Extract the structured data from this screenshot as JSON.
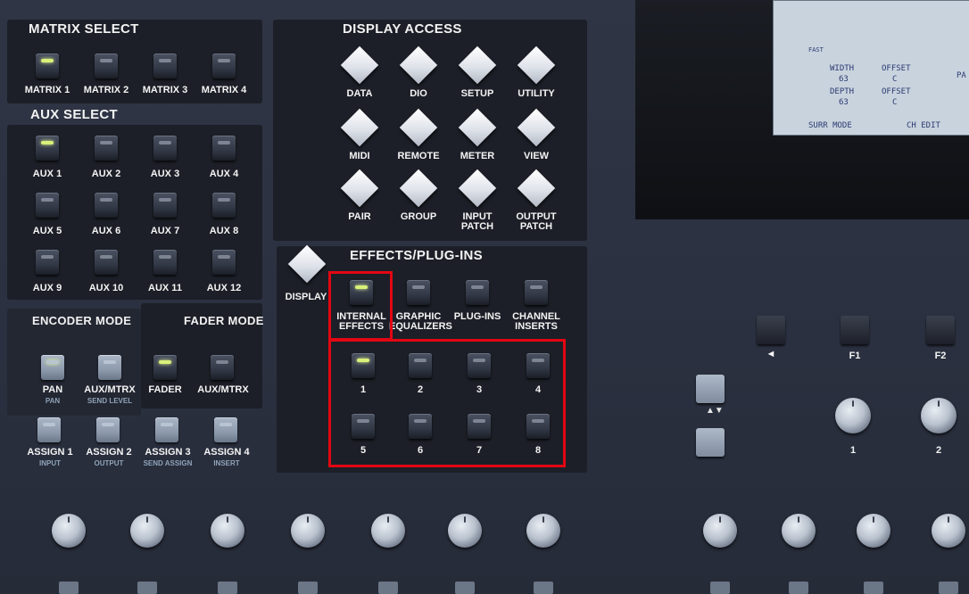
{
  "colors": {
    "accent": "#e30613",
    "led_on": "#d9f07a",
    "panel": "#1c1f27"
  },
  "matrix_select": {
    "title": "MATRIX SELECT",
    "buttons": [
      {
        "label": "MATRIX 1",
        "led": "on"
      },
      {
        "label": "MATRIX 2",
        "led": "off"
      },
      {
        "label": "MATRIX 3",
        "led": "off"
      },
      {
        "label": "MATRIX 4",
        "led": "off"
      }
    ]
  },
  "aux_select": {
    "title": "AUX SELECT",
    "buttons": [
      {
        "label": "AUX 1",
        "led": "on"
      },
      {
        "label": "AUX 2",
        "led": "off"
      },
      {
        "label": "AUX 3",
        "led": "off"
      },
      {
        "label": "AUX 4",
        "led": "off"
      },
      {
        "label": "AUX 5",
        "led": "off"
      },
      {
        "label": "AUX 6",
        "led": "off"
      },
      {
        "label": "AUX 7",
        "led": "off"
      },
      {
        "label": "AUX 8",
        "led": "off"
      },
      {
        "label": "AUX 9",
        "led": "off"
      },
      {
        "label": "AUX 10",
        "led": "off"
      },
      {
        "label": "AUX 11",
        "led": "off"
      },
      {
        "label": "AUX 12",
        "led": "off"
      }
    ]
  },
  "encoder_mode": {
    "title": "ENCODER MODE",
    "buttons": [
      {
        "label": "PAN",
        "sub": "PAN",
        "led": "on"
      },
      {
        "label": "AUX/MTRX",
        "sub": "SEND LEVEL",
        "led": "off"
      }
    ]
  },
  "fader_mode": {
    "title": "FADER MODE",
    "buttons": [
      {
        "label": "FADER",
        "led": "on"
      },
      {
        "label": "AUX/MTRX",
        "led": "off"
      }
    ]
  },
  "assign": {
    "buttons": [
      {
        "label": "ASSIGN 1",
        "sub": "INPUT"
      },
      {
        "label": "ASSIGN 2",
        "sub": "OUTPUT"
      },
      {
        "label": "ASSIGN 3",
        "sub": "SEND ASSIGN"
      },
      {
        "label": "ASSIGN 4",
        "sub": "INSERT"
      }
    ]
  },
  "display_access": {
    "title": "DISPLAY ACCESS",
    "keys": [
      {
        "label": "DATA"
      },
      {
        "label": "DIO"
      },
      {
        "label": "SETUP"
      },
      {
        "label": "UTILITY"
      },
      {
        "label": "MIDI"
      },
      {
        "label": "REMOTE"
      },
      {
        "label": "METER"
      },
      {
        "label": "VIEW"
      },
      {
        "label": "PAIR"
      },
      {
        "label": "GROUP"
      },
      {
        "label": "INPUT\nPATCH"
      },
      {
        "label": "OUTPUT\nPATCH"
      }
    ]
  },
  "effects": {
    "title": "EFFECTS/PLUG-INS",
    "display_label": "DISPLAY",
    "categories": [
      {
        "label": "INTERNAL\nEFFECTS",
        "led": "on"
      },
      {
        "label": "GRAPHIC\nEQUALIZERS",
        "led": "off"
      },
      {
        "label": "PLUG-INS",
        "led": "off"
      },
      {
        "label": "CHANNEL\nINSERTS",
        "led": "off"
      }
    ],
    "slots": [
      {
        "label": "1",
        "led": "on"
      },
      {
        "label": "2",
        "led": "off"
      },
      {
        "label": "3",
        "led": "off"
      },
      {
        "label": "4",
        "led": "off"
      },
      {
        "label": "5",
        "led": "off"
      },
      {
        "label": "6",
        "led": "off"
      },
      {
        "label": "7",
        "led": "off"
      },
      {
        "label": "8",
        "led": "off"
      }
    ]
  },
  "lcd": {
    "width_label": "WIDTH",
    "offset_label": "OFFSET",
    "depth_label": "DEPTH",
    "offset2_label": "OFFSET",
    "width_value": "63",
    "offset_value": "C",
    "depth_value": "63",
    "offset2_value": "C",
    "tab1": "SURR MODE",
    "tab2": "CH EDIT",
    "fast_label": "FAST",
    "pa_label": "PA"
  },
  "function_keys": {
    "left_arrow": "◄",
    "f1": "F1",
    "f2": "F2",
    "knob1": "1",
    "knob2": "2"
  },
  "icons": {
    "led": "led-icon",
    "knob": "rotary-knob-icon",
    "arrow": "up-down-arrow-icon"
  }
}
